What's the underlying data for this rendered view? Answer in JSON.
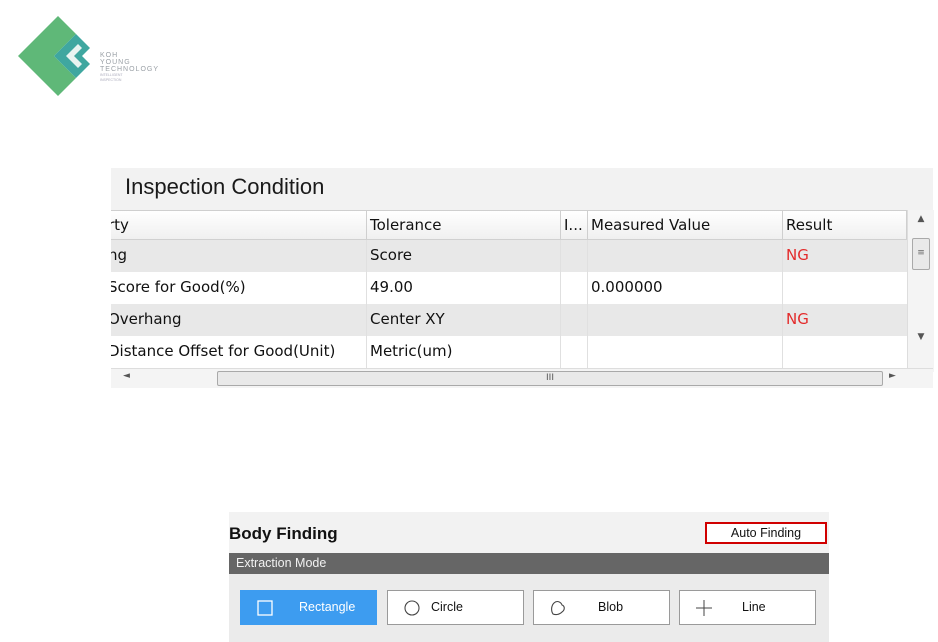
{
  "logo": {
    "line1": "KOH",
    "line2": "YOUNG",
    "line3": "TECHNOLOGY",
    "tag1": "INTELLIGENT",
    "tag2": "INSPECTION",
    "colors": {
      "green": "#5fb878",
      "teal": "#3fa7a0"
    }
  },
  "inspection": {
    "title": "Inspection Condition",
    "columns": [
      "rty",
      "Tolerance",
      "I...",
      "Measured Value",
      "Result"
    ],
    "rows": [
      {
        "property": "ng",
        "tolerance": "Score",
        "i": "",
        "measured": "",
        "result": "NG"
      },
      {
        "property": "Score for Good(%)",
        "tolerance": "49.00",
        "i": "",
        "measured": "0.000000",
        "result": ""
      },
      {
        "property": "Overhang",
        "tolerance": "Center XY",
        "i": "",
        "measured": "",
        "result": "NG"
      },
      {
        "property": "Distance Offset for Good(Unit)",
        "tolerance": "Metric(um)",
        "i": "",
        "measured": "",
        "result": ""
      }
    ],
    "scroll": {
      "up": "▲",
      "down": "▼",
      "left": "◄",
      "right": "►",
      "grip": "III",
      "vgrip": "≡"
    },
    "ng_color": "#e32b2b"
  },
  "body_finding": {
    "title": "Body Finding",
    "auto_finding_label": "Auto Finding",
    "extraction_mode_label": "Extraction Mode",
    "modes": [
      {
        "label": "Rectangle",
        "icon": "square-icon",
        "selected": true
      },
      {
        "label": "Circle",
        "icon": "circle-icon",
        "selected": false
      },
      {
        "label": "Blob",
        "icon": "blob-icon",
        "selected": false
      },
      {
        "label": "Line",
        "icon": "plus-icon",
        "selected": false
      }
    ],
    "selected_color": "#3d9cf0"
  }
}
